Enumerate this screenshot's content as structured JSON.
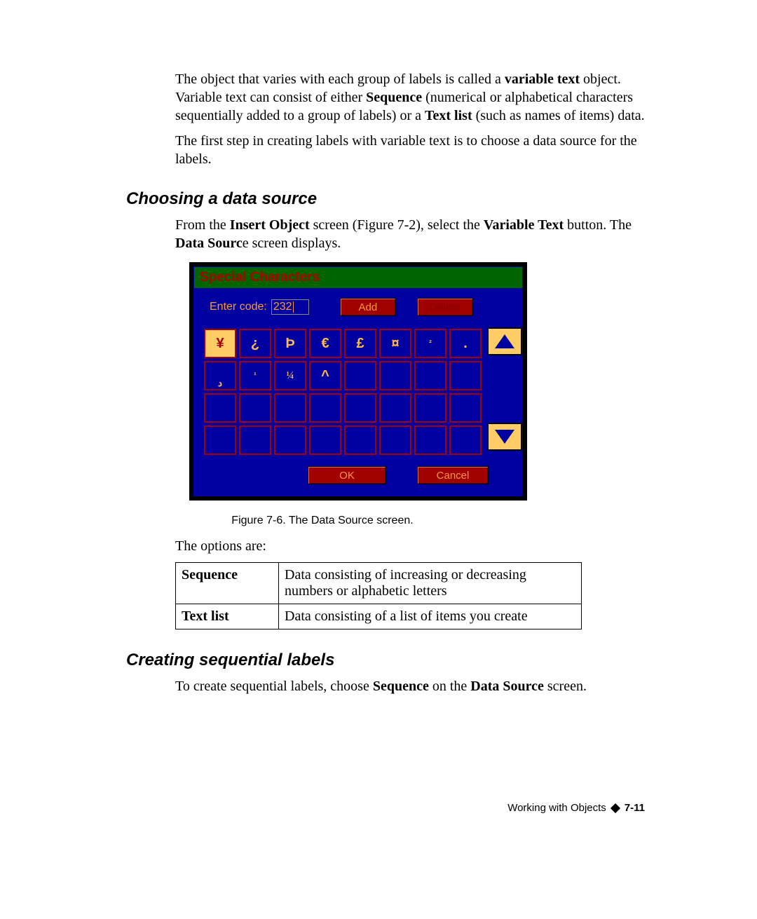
{
  "para1_a": "The object that varies with each group of labels is called a ",
  "para1_b": "variable text",
  "para1_c": " object. Variable text can consist of either ",
  "para1_d": "Sequence",
  "para1_e": " (numerical or alphabetical characters sequentially added to a group of labels) or a ",
  "para1_f": "Text list",
  "para1_g": " (such as names of items) data.",
  "para2": "The first step in creating labels with variable text is to choose a data source for the labels.",
  "heading1": "Choosing a data source",
  "para3_a": "From the ",
  "para3_b": "Insert Object",
  "para3_c": " screen (Figure 7-2), select the ",
  "para3_d": "Variable Text",
  "para3_e": " button. The ",
  "para3_f": "Data Sourc",
  "para3_g": "e screen displays.",
  "screenshot": {
    "title": "Special Characters",
    "enter_code_label": "Enter code:",
    "code_value": "232",
    "add": "Add",
    "delete": "Delete",
    "ok": "OK",
    "cancel": "Cancel",
    "chars": [
      "¥",
      "¿",
      "Þ",
      "€",
      "£",
      "¤",
      "²",
      ".",
      "د",
      "¹",
      "¼",
      "^"
    ]
  },
  "figure_caption": "Figure 7-6. The Data Source screen.",
  "options_intro": "The options are:",
  "options": {
    "row1_label": "Sequence",
    "row1_desc": "Data consisting of increasing or decreasing numbers or alphabetic letters",
    "row2_label": "Text list",
    "row2_desc": "Data consisting of a list of items you create"
  },
  "heading2": "Creating sequential labels",
  "para4_a": "To create sequential labels, choose ",
  "para4_b": "Sequence",
  "para4_c": " on the ",
  "para4_d": "Data Source",
  "para4_e": " screen.",
  "footer_text": "Working with Objects",
  "footer_page": "7-11"
}
